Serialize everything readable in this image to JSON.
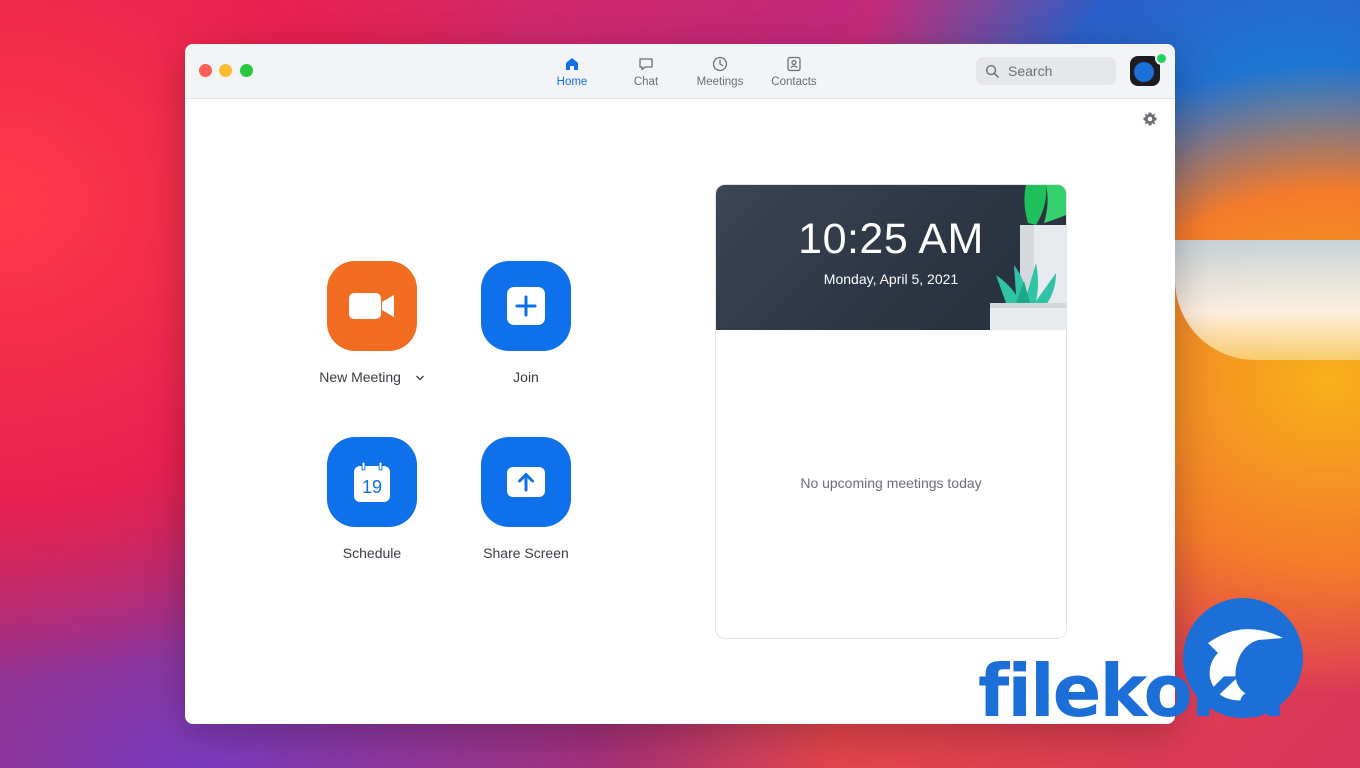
{
  "window": {
    "tabs": [
      {
        "label": "Home",
        "icon": "home-icon",
        "active": true
      },
      {
        "label": "Chat",
        "icon": "chat-icon",
        "active": false
      },
      {
        "label": "Meetings",
        "icon": "clock-icon",
        "active": false
      },
      {
        "label": "Contacts",
        "icon": "contacts-icon",
        "active": false
      }
    ],
    "search_placeholder": "Search"
  },
  "actions": {
    "new_meeting": "New Meeting",
    "join": "Join",
    "schedule": "Schedule",
    "schedule_day": "19",
    "share_screen": "Share Screen"
  },
  "meetings_card": {
    "time": "10:25 AM",
    "date": "Monday, April 5, 2021",
    "empty_message": "No upcoming meetings today"
  },
  "watermark": {
    "text": "filekoka"
  },
  "colors": {
    "accent": "#0e71eb",
    "new_meeting": "#f26d21",
    "presence": "#23d160"
  }
}
